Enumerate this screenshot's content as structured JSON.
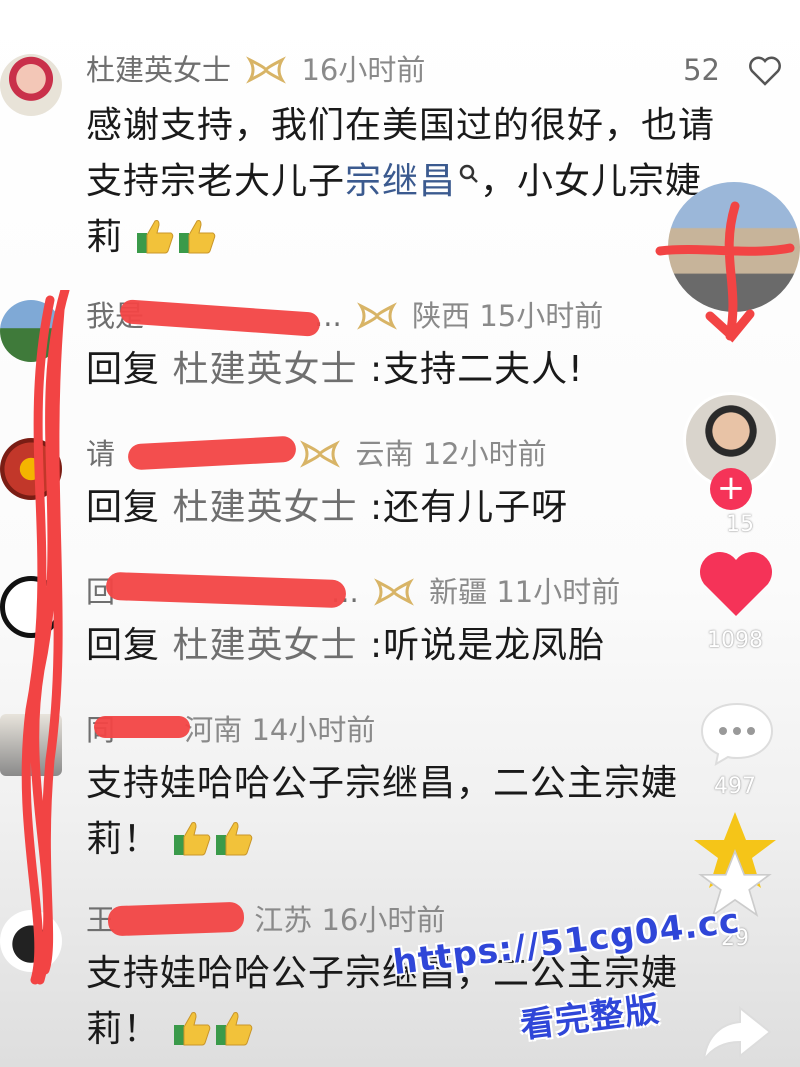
{
  "comments": [
    {
      "name": "杜建英女士",
      "badge_icon": "ribbon-icon",
      "time": "16小时前",
      "likes": "52",
      "text_line1": "感谢支持，我们在美国过的很好，也请",
      "text_line2a": "支持宗老大儿子",
      "link": "宗继昌",
      "text_line2b": "，小女儿宗婕",
      "text_line3": "莉"
    },
    {
      "name": "我是",
      "name_tail": "...",
      "location": "陕西",
      "time": "15小时前",
      "reply_prefix": "回复",
      "reply_to": "杜建英女士",
      "text": ":支持二夫人!"
    },
    {
      "name": "请",
      "location": "云南",
      "time": "12小时前",
      "reply_prefix": "回复",
      "reply_to": "杜建英女士",
      "text": ":还有儿子呀"
    },
    {
      "name": "回",
      "name_tail": "...",
      "location": "新疆",
      "time": "11小时前",
      "reply_prefix": "回复",
      "reply_to": "杜建英女士",
      "text": ":听说是龙凤胎"
    },
    {
      "name": "同",
      "location": "河南",
      "time": "14小时前",
      "text_line1": "支持娃哈哈公子宗继昌，二公主宗婕",
      "text_line2": "莉！"
    },
    {
      "name": "王",
      "location": "江苏",
      "time": "16小时前",
      "text_line1": "支持娃哈哈公子宗继昌，二公主宗婕",
      "text_line2": "莉！"
    }
  ],
  "rail": {
    "follow_count": "15",
    "likes": "1098",
    "comments": "497",
    "favorites": "29"
  },
  "watermark": {
    "line1": "https://51cg04.cc",
    "line2": "看完整版"
  },
  "colors": {
    "redact": "#f24444",
    "like_heart": "#f53358",
    "star": "#f5c518",
    "watermark": "#2f46d8"
  }
}
